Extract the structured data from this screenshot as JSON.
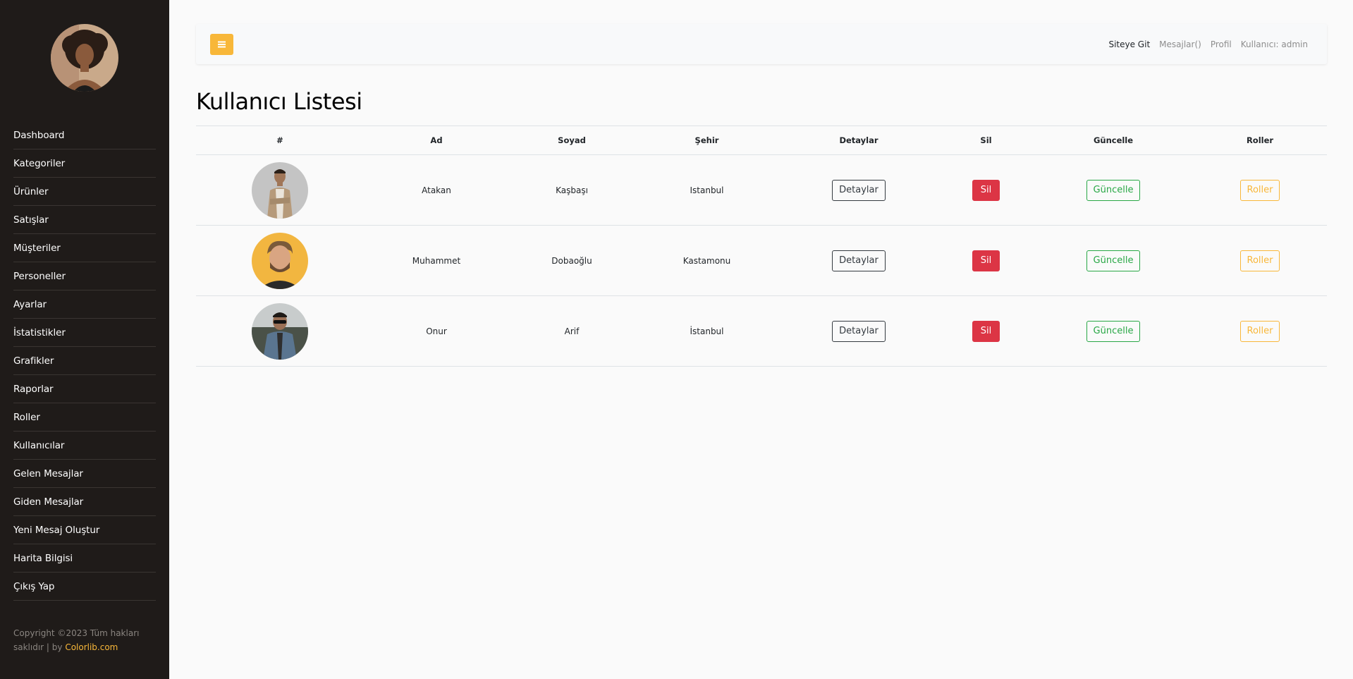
{
  "sidebar": {
    "items": [
      {
        "label": "Dashboard"
      },
      {
        "label": "Kategoriler"
      },
      {
        "label": "Ürünler"
      },
      {
        "label": "Satışlar"
      },
      {
        "label": "Müşteriler"
      },
      {
        "label": "Personeller"
      },
      {
        "label": "Ayarlar"
      },
      {
        "label": "İstatistikler"
      },
      {
        "label": "Grafikler"
      },
      {
        "label": "Raporlar"
      },
      {
        "label": "Roller"
      },
      {
        "label": "Kullanıcılar"
      },
      {
        "label": "Gelen Mesajlar"
      },
      {
        "label": "Giden Mesajlar"
      },
      {
        "label": "Yeni Mesaj Oluştur"
      },
      {
        "label": "Harita Bilgisi"
      },
      {
        "label": "Çıkış Yap"
      }
    ],
    "copyright_text": "Copyright ©2023 Tüm hakları saklıdır | by ",
    "copyright_brand": "Colorlib.com"
  },
  "topbar": {
    "links": {
      "site": "Siteye Git",
      "messages": "Mesajlar()",
      "profile": "Profil",
      "user": "Kullanıcı: admin"
    }
  },
  "page": {
    "title": "Kullanıcı Listesi"
  },
  "table": {
    "headers": {
      "num": "#",
      "ad": "Ad",
      "soyad": "Soyad",
      "sehir": "Şehir",
      "detaylar": "Detaylar",
      "sil": "Sil",
      "guncelle": "Güncelle",
      "roller": "Roller"
    },
    "rows": [
      {
        "ad": "Atakan",
        "soyad": "Kaşbaşı",
        "sehir": "Istanbul"
      },
      {
        "ad": "Muhammet",
        "soyad": "Dobaoğlu",
        "sehir": "Kastamonu"
      },
      {
        "ad": "Onur",
        "soyad": "Arif",
        "sehir": "İstanbul"
      }
    ],
    "buttons": {
      "detay": "Detaylar",
      "sil": "Sil",
      "guncelle": "Güncelle",
      "roller": "Roller"
    }
  },
  "colors": {
    "sidebar_bg": "#1f1b19",
    "accent": "#f8b739",
    "danger": "#dc3545",
    "success": "#28a745",
    "dark": "#343a40"
  }
}
